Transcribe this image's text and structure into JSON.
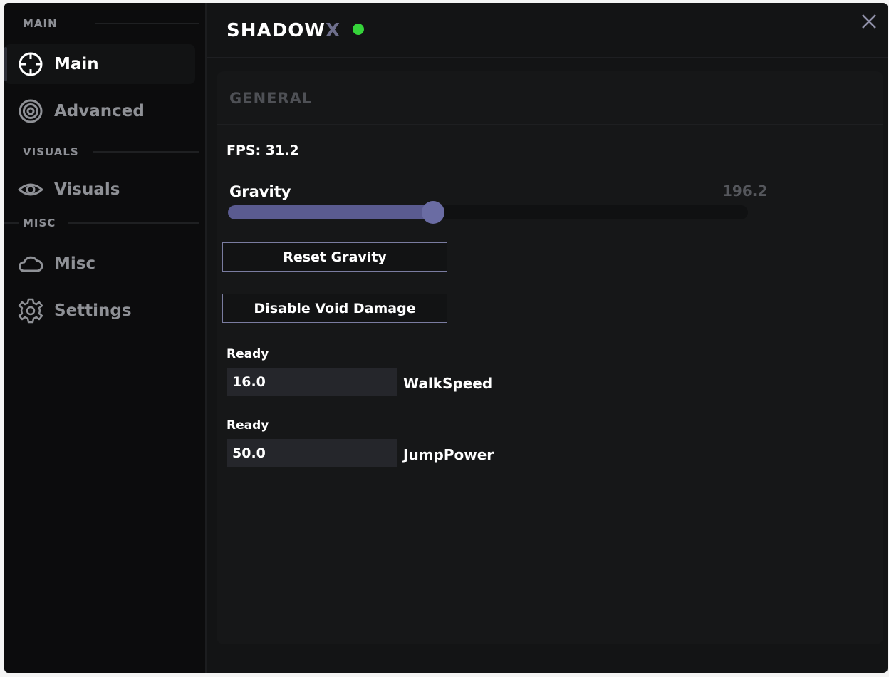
{
  "app": {
    "brand_main": "SHADOW",
    "brand_accent": "X",
    "status_color": "#35d43a"
  },
  "sidebar": {
    "sections": {
      "main": "MAIN",
      "visuals": "VISUALS",
      "misc": "MISC"
    },
    "items": [
      {
        "label": "Main",
        "icon": "crosshair-icon",
        "active": true
      },
      {
        "label": "Advanced",
        "icon": "target-icon",
        "active": false
      },
      {
        "label": "Visuals",
        "icon": "eye-icon",
        "active": false
      },
      {
        "label": "Misc",
        "icon": "cloud-icon",
        "active": false
      },
      {
        "label": "Settings",
        "icon": "gear-icon",
        "active": false
      }
    ]
  },
  "panel": {
    "title": "GENERAL",
    "fps": "FPS: 31.2",
    "gravity": {
      "label": "Gravity",
      "value": "196.2",
      "fill_fraction": 0.395
    },
    "buttons": {
      "reset_gravity": "Reset Gravity",
      "disable_void": "Disable Void Damage"
    },
    "walkspeed": {
      "status": "Ready",
      "value": "16.0",
      "label": "WalkSpeed"
    },
    "jumppower": {
      "status": "Ready",
      "value": "50.0",
      "label": "JumpPower"
    }
  },
  "colors": {
    "accent": "#5a5b90",
    "background": "#131415",
    "sidebar": "#0c0c0d"
  }
}
